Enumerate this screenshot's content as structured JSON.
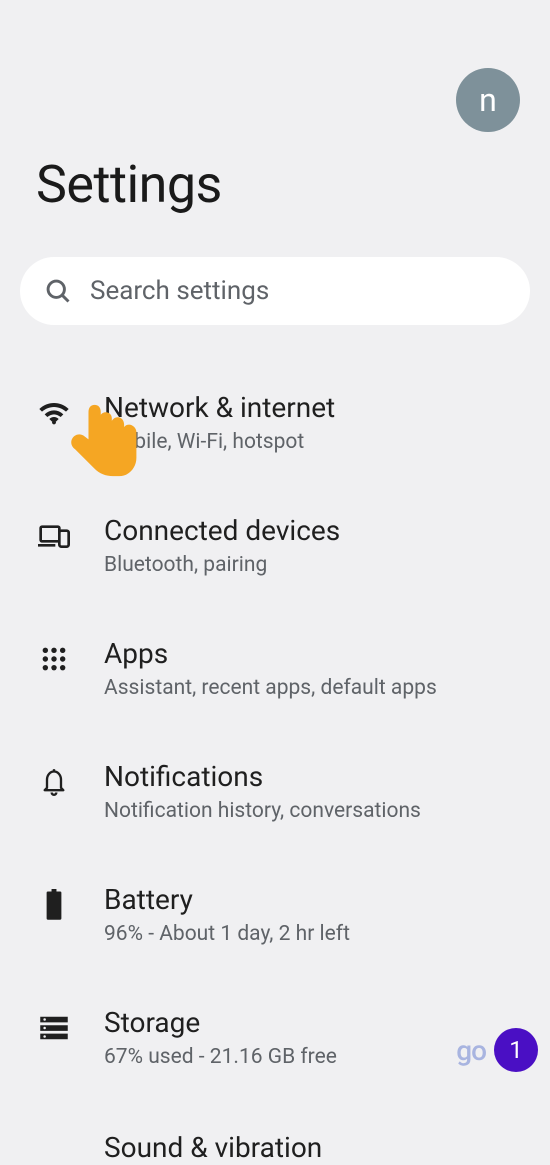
{
  "header": {
    "avatar_letter": "n",
    "title": "Settings"
  },
  "search": {
    "placeholder": "Search settings"
  },
  "items": [
    {
      "title": "Network & internet",
      "subtitle": "Mobile, Wi-Fi, hotspot"
    },
    {
      "title": "Connected devices",
      "subtitle": "Bluetooth, pairing"
    },
    {
      "title": "Apps",
      "subtitle": "Assistant, recent apps, default apps"
    },
    {
      "title": "Notifications",
      "subtitle": "Notification history, conversations"
    },
    {
      "title": "Battery",
      "subtitle": "96% - About 1 day, 2 hr left"
    },
    {
      "title": "Storage",
      "subtitle": "67% used - 21.16 GB free"
    }
  ],
  "partial_item": {
    "title": "Sound & vibration"
  },
  "badges": {
    "logo": "go",
    "count": "1"
  }
}
